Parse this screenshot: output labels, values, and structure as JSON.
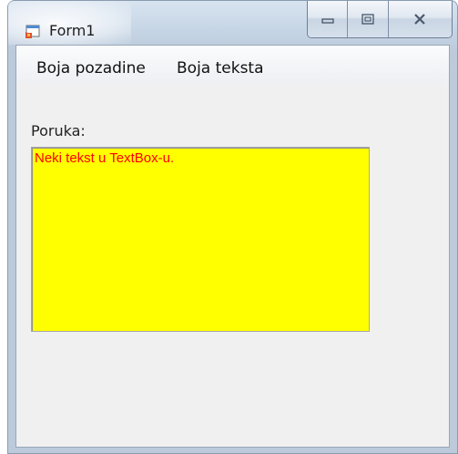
{
  "window": {
    "title": "Form1",
    "icon": "winforms-app-icon"
  },
  "caption_buttons": {
    "minimize_icon": "minimize-icon",
    "maximize_icon": "maximize-icon",
    "close_icon": "close-icon"
  },
  "menu": {
    "items": [
      {
        "label": "Boja pozadine"
      },
      {
        "label": "Boja teksta"
      }
    ]
  },
  "form": {
    "message_label": "Poruka:",
    "textbox_value": "Neki tekst u TextBox-u.",
    "textbox_background": "#ffff00",
    "textbox_text_color": "#ff0000"
  }
}
